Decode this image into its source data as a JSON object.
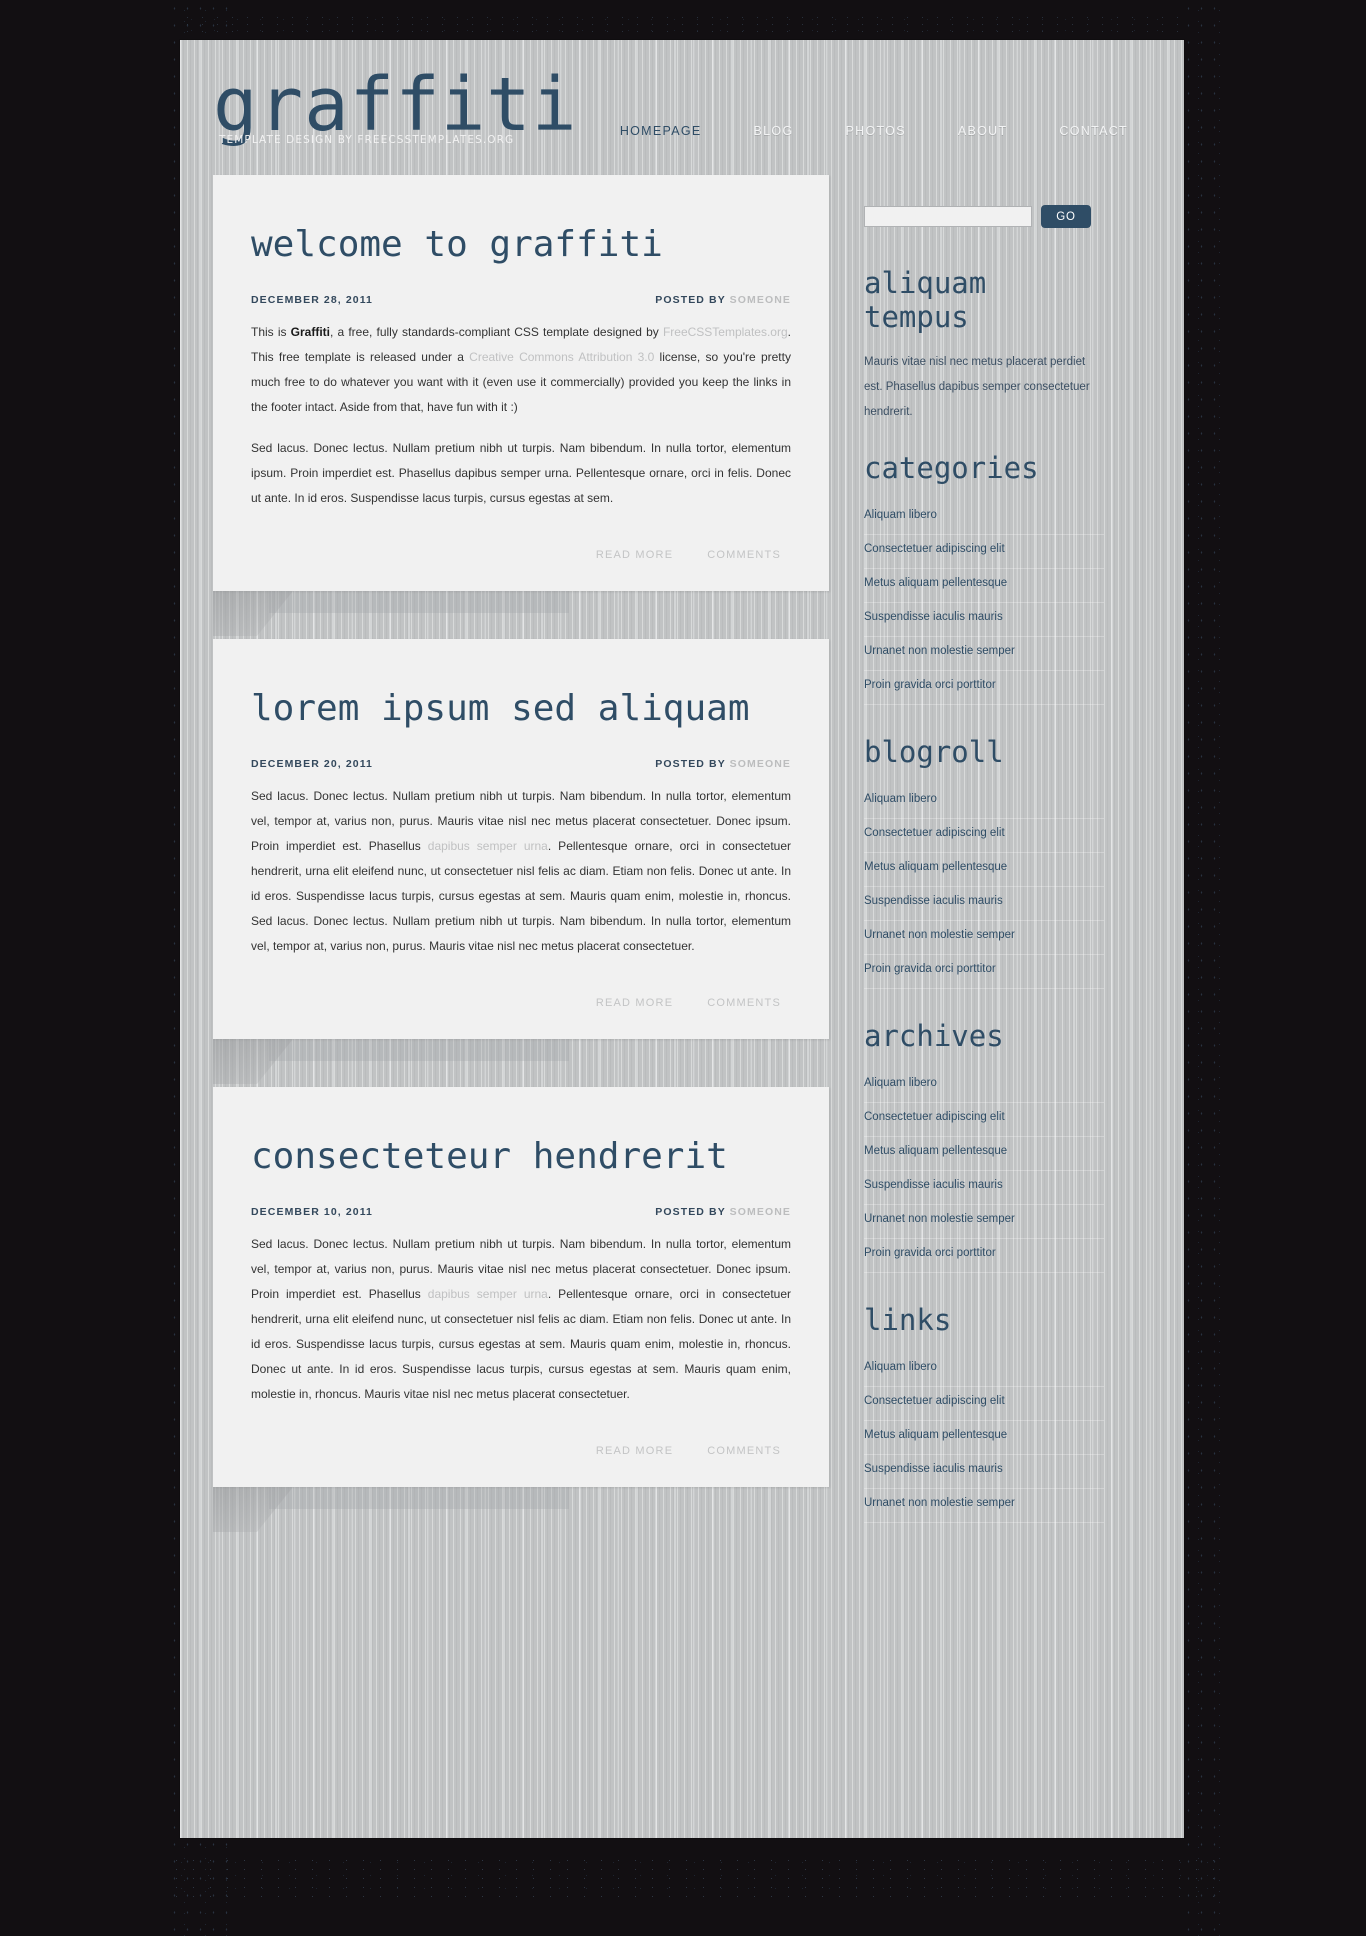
{
  "site": {
    "logo": "graffiti",
    "tagline": "TEMPLATE DESIGN BY FREECSSTEMPLATES.ORG",
    "accent_color": "#2f4d66",
    "paper_color": "#f1f1f1",
    "background_color": "#120f12"
  },
  "menu": [
    {
      "label": "HOMEPAGE",
      "active": true
    },
    {
      "label": "BLOG",
      "active": false
    },
    {
      "label": "PHOTOS",
      "active": false
    },
    {
      "label": "ABOUT",
      "active": false
    },
    {
      "label": "CONTACT",
      "active": false
    }
  ],
  "posts": [
    {
      "title": "welcome to graffiti",
      "date": "DECEMBER 28, 2011",
      "posted_by_label": "POSTED BY",
      "author": "SOMEONE",
      "paragraphs": [
        {
          "parts": [
            {
              "text": "This is ",
              "style": "normal"
            },
            {
              "text": "Graffiti",
              "style": "strong"
            },
            {
              "text": ", a free, fully standards-compliant CSS template designed by ",
              "style": "normal"
            },
            {
              "text": "FreeCSSTemplates.org",
              "style": "link"
            },
            {
              "text": ". This free template is released under a ",
              "style": "normal"
            },
            {
              "text": "Creative Commons Attribution 3.0",
              "style": "link"
            },
            {
              "text": " license, so you're pretty much free to do whatever you want with it (even use it commercially) provided you keep the links in the footer intact. Aside from that, have fun with it :)",
              "style": "normal"
            }
          ]
        },
        {
          "parts": [
            {
              "text": "Sed lacus. Donec lectus. Nullam pretium nibh ut turpis. Nam bibendum. In nulla tortor, elementum ipsum. Proin imperdiet est. Phasellus dapibus semper urna. Pellentesque ornare, orci in felis. Donec ut ante. In id eros. Suspendisse lacus turpis, cursus egestas at sem.",
              "style": "normal"
            }
          ]
        }
      ],
      "read_more": "READ MORE",
      "comments": "COMMENTS"
    },
    {
      "title": "lorem ipsum sed aliquam",
      "date": "DECEMBER 20, 2011",
      "posted_by_label": "POSTED BY",
      "author": "SOMEONE",
      "paragraphs": [
        {
          "parts": [
            {
              "text": "Sed lacus. Donec lectus. Nullam pretium nibh ut turpis. Nam bibendum. In nulla tortor, elementum vel, tempor at, varius non, purus. Mauris vitae nisl nec metus placerat consectetuer. Donec ipsum. Proin imperdiet est. Phasellus ",
              "style": "normal"
            },
            {
              "text": "dapibus semper urna",
              "style": "link"
            },
            {
              "text": ". Pellentesque ornare, orci in consectetuer hendrerit, urna elit eleifend nunc, ut consectetuer nisl felis ac diam. Etiam non felis. Donec ut ante. In id eros. Suspendisse lacus turpis, cursus egestas at sem. Mauris quam enim, molestie in, rhoncus. Sed lacus. Donec lectus. Nullam pretium nibh ut turpis. Nam bibendum. In nulla tortor, elementum vel, tempor at, varius non, purus. Mauris vitae nisl nec metus placerat consectetuer.",
              "style": "normal"
            }
          ]
        }
      ],
      "read_more": "READ MORE",
      "comments": "COMMENTS"
    },
    {
      "title": "consecteteur hendrerit",
      "date": "DECEMBER 10, 2011",
      "posted_by_label": "POSTED BY",
      "author": "SOMEONE",
      "paragraphs": [
        {
          "parts": [
            {
              "text": "Sed lacus. Donec lectus. Nullam pretium nibh ut turpis. Nam bibendum. In nulla tortor, elementum vel, tempor at, varius non, purus. Mauris vitae nisl nec metus placerat consectetuer. Donec ipsum. Proin imperdiet est. Phasellus ",
              "style": "normal"
            },
            {
              "text": "dapibus semper urna",
              "style": "link"
            },
            {
              "text": ". Pellentesque ornare, orci in consectetuer hendrerit, urna elit eleifend nunc, ut consectetuer nisl felis ac diam. Etiam non felis. Donec ut ante. In id eros. Suspendisse lacus turpis, cursus egestas at sem. Mauris quam enim, molestie in, rhoncus. Donec ut ante. In id eros. Suspendisse lacus turpis, cursus egestas at sem. Mauris quam enim, molestie in, rhoncus. Mauris vitae nisl nec metus placerat consectetuer.",
              "style": "normal"
            }
          ]
        }
      ],
      "read_more": "READ MORE",
      "comments": "COMMENTS"
    }
  ],
  "sidebar": {
    "search": {
      "value": "",
      "placeholder": "",
      "button_label": "GO"
    },
    "boxes": [
      {
        "heading": "aliquam tempus",
        "type": "text",
        "body": "Mauris vitae nisl nec metus placerat perdiet est. Phasellus dapibus semper consectetuer hendrerit."
      },
      {
        "heading": "categories",
        "type": "list",
        "items": [
          "Aliquam libero",
          "Consectetuer adipiscing elit",
          "Metus aliquam pellentesque",
          "Suspendisse iaculis mauris",
          "Urnanet non molestie semper",
          "Proin gravida orci porttitor"
        ]
      },
      {
        "heading": "blogroll",
        "type": "list",
        "items": [
          "Aliquam libero",
          "Consectetuer adipiscing elit",
          "Metus aliquam pellentesque",
          "Suspendisse iaculis mauris",
          "Urnanet non molestie semper",
          "Proin gravida orci porttitor"
        ]
      },
      {
        "heading": "archives",
        "type": "list",
        "items": [
          "Aliquam libero",
          "Consectetuer adipiscing elit",
          "Metus aliquam pellentesque",
          "Suspendisse iaculis mauris",
          "Urnanet non molestie semper",
          "Proin gravida orci porttitor"
        ]
      },
      {
        "heading": "links",
        "type": "list",
        "items": [
          "Aliquam libero",
          "Consectetuer adipiscing elit",
          "Metus aliquam pellentesque",
          "Suspendisse iaculis mauris",
          "Urnanet non molestie semper"
        ]
      }
    ]
  }
}
